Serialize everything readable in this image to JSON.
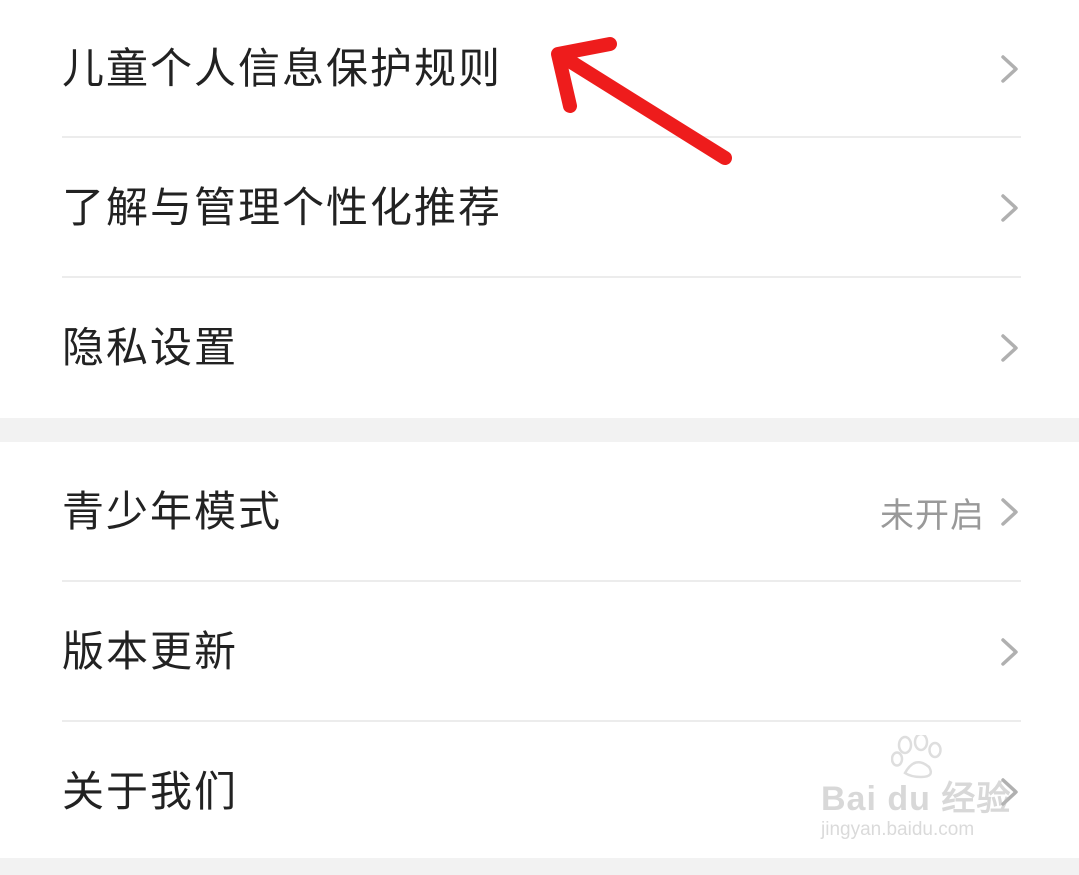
{
  "settings": {
    "group1": [
      {
        "label": "儿童个人信息保护规则",
        "value": ""
      },
      {
        "label": "了解与管理个性化推荐",
        "value": ""
      },
      {
        "label": "隐私设置",
        "value": ""
      }
    ],
    "group2": [
      {
        "label": "青少年模式",
        "value": "未开启"
      },
      {
        "label": "版本更新",
        "value": ""
      },
      {
        "label": "关于我们",
        "value": ""
      }
    ]
  },
  "annotation": {
    "arrow_color": "#ee1c1c"
  },
  "watermark": {
    "brand": "Bai du 经验",
    "url": "jingyan.baidu.com"
  },
  "colors": {
    "text": "#222222",
    "secondary_text": "#999999",
    "divider": "#ececec",
    "section_gap": "#f2f2f2",
    "chevron": "#b0b0b0"
  }
}
